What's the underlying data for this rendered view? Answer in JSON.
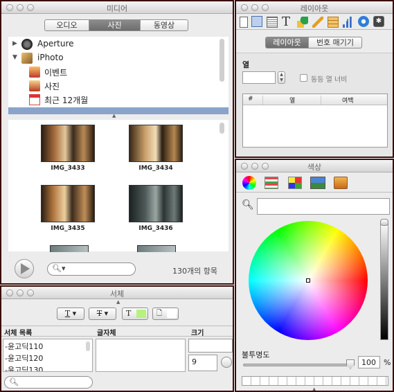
{
  "media": {
    "title": "미디어",
    "tabs": [
      "오디오",
      "사진",
      "동영상"
    ],
    "tree": {
      "aperture": "Aperture",
      "iphoto": "iPhoto",
      "events": "이벤트",
      "photos": "사진",
      "recent": "최근 12개월"
    },
    "photos": [
      "IMG_3433",
      "IMG_3434",
      "IMG_3435",
      "IMG_3436"
    ],
    "count": "130개의 항목"
  },
  "inspector": {
    "title": "레이아웃",
    "tabs": [
      "레이아웃",
      "번호 매기기"
    ],
    "column_label": "열",
    "equal_width_label": "동등 열 너비",
    "table_headers": [
      "#",
      "열",
      "여백"
    ]
  },
  "fonts": {
    "title": "서체",
    "list_headers": [
      "서체 목록",
      "글자체",
      "크기"
    ],
    "families": [
      "-윤고딕110",
      "-윤고딕120",
      "-윤고딕130"
    ],
    "size_value": "9"
  },
  "colors": {
    "title": "색상",
    "opacity_label": "불투명도",
    "opacity_value": "100",
    "percent": "%"
  }
}
